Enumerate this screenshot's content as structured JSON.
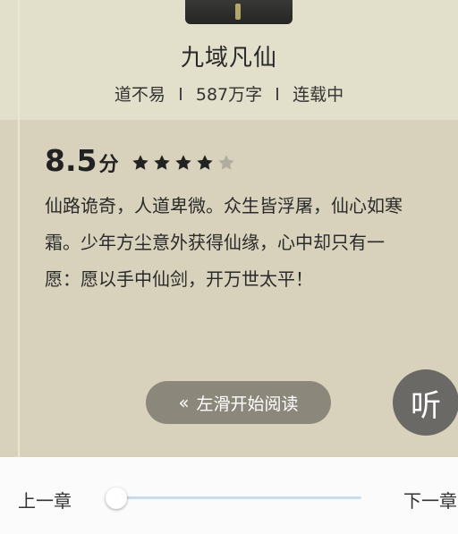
{
  "book": {
    "title": "九域凡仙",
    "author": "道不易",
    "word_count": "587万字",
    "status": "连载中"
  },
  "rating": {
    "score": "8.5",
    "unit": "分",
    "stars_filled": 4,
    "stars_total": 5,
    "star_color": "#222222",
    "star_empty_color": "#b0ad9f"
  },
  "intro": {
    "lines": [
      "仙路诡奇，人道卑微。众生皆浮屠，仙心如寒",
      "霜。少年方尘意外获得仙缘，心中却只有一",
      "愿：愿以手中仙剑，开万世太平！"
    ]
  },
  "swipe": {
    "chevrons": "‹‹",
    "label": "左滑开始阅读"
  },
  "listen": {
    "label": "听"
  },
  "chapter_nav": {
    "prev_label": "上一章",
    "next_label": "下一章",
    "progress": 0
  }
}
